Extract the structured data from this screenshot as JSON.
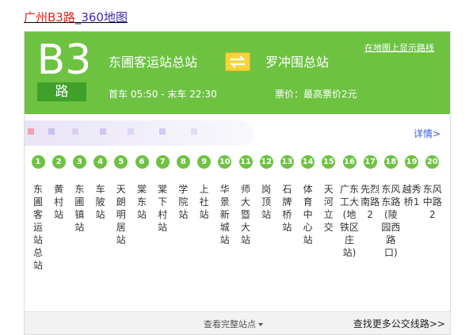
{
  "page_title": {
    "line_name": "广州B3路",
    "sep": "_",
    "site": "360地图"
  },
  "header": {
    "route_number": "B3",
    "route_suffix": "路",
    "from_station": "东圃客运站总站",
    "to_station": "罗冲围总站",
    "map_link": "在地图上显示路线",
    "times": "首车 05:50 - 末车 22:30",
    "price": "票价：最高票价2元",
    "swap_icon": "swap-arrows-icon",
    "accent_color": "#6dc242",
    "swap_color": "#f7d53a"
  },
  "detail_link": "详情>",
  "stops": [
    {
      "num": "1",
      "name": "东圃客运站总站"
    },
    {
      "num": "2",
      "name": "黄村站"
    },
    {
      "num": "3",
      "name": "东圃镇站"
    },
    {
      "num": "4",
      "name": "车陂站"
    },
    {
      "num": "5",
      "name": "天朗明居站"
    },
    {
      "num": "6",
      "name": "棠东站"
    },
    {
      "num": "7",
      "name": "棠下村站"
    },
    {
      "num": "8",
      "name": "学院站"
    },
    {
      "num": "9",
      "name": "上社站"
    },
    {
      "num": "10",
      "name": "华景新城站"
    },
    {
      "num": "11",
      "name": "师大暨大站"
    },
    {
      "num": "12",
      "name": "岗顶站"
    },
    {
      "num": "13",
      "name": "石牌桥站"
    },
    {
      "num": "14",
      "name": "体育中心站"
    },
    {
      "num": "15",
      "name": "天河立交"
    },
    {
      "num": "16",
      "name": "广东工大(地铁区庄站)"
    },
    {
      "num": "17",
      "name": "先烈南路2"
    },
    {
      "num": "18",
      "name": "东风东路(陵园西路口)"
    },
    {
      "num": "19",
      "name": "越秀桥1"
    },
    {
      "num": "20",
      "name": "东风中路2"
    }
  ],
  "footer": {
    "view_all": "查看完整站点",
    "find_more": "查找更多公交线路>>"
  }
}
